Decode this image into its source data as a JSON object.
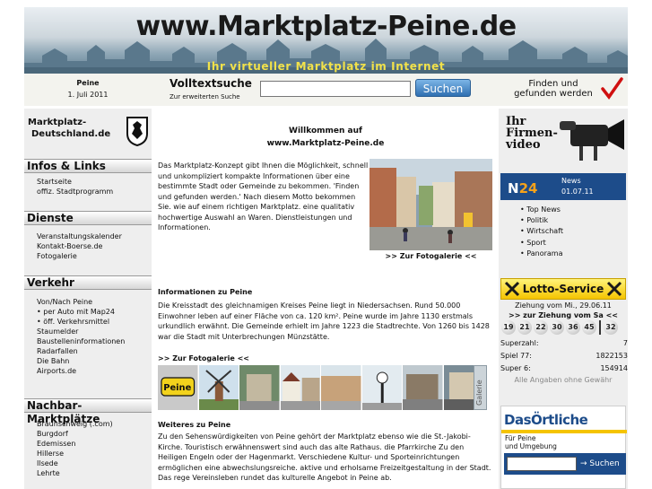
{
  "header": {
    "site_title": "www.Marktplatz-Peine.de",
    "tagline": "Ihr virtueller Marktplatz im Internet"
  },
  "location": {
    "city": "Peine",
    "date": "1. Juli 2011"
  },
  "search": {
    "title": "Volltextsuche",
    "sub": "Zur erweiterten Suche",
    "button": "Suchen",
    "slogan_line1": "Finden und",
    "slogan_line2": "gefunden werden"
  },
  "left": {
    "logo_line1": "Marktplatz-",
    "logo_line2": "Deutschland.de",
    "sections": [
      {
        "title": "Infos & Links",
        "items": [
          "Startseite",
          "offiz. Stadtprogramm"
        ]
      },
      {
        "title": "Dienste",
        "items": [
          "Veranstaltungskalender",
          "Kontakt-Boerse.de",
          "Fotogalerie"
        ]
      },
      {
        "title": "Verkehr",
        "items": [
          "Von/Nach Peine",
          "• per Auto mit Map24",
          "• öff. Verkehrsmittel",
          "Staumelder",
          "Baustelleninformationen",
          "Radarfallen",
          "Die Bahn",
          "Airports.de"
        ]
      },
      {
        "title": "Nachbar-Marktplätze",
        "items": [
          "Braunschweig (.com)",
          "Burgdorf",
          "Edemissen",
          "Hillerse",
          "Ilsede",
          "Lehrte"
        ]
      }
    ]
  },
  "main": {
    "welcome_line1": "Willkommen auf",
    "welcome_line2": "www.Marktplatz-Peine.de",
    "intro": "Das Marktplatz-Konzept gibt Ihnen die Möglichkeit, schnell und unkompliziert kompakte Informationen über eine bestimmte Stadt oder Gemeinde zu bekommen. 'Finden und gefunden werden.' Nach diesem Motto bekommen Sie. wie auf einem richtigen Marktplatz. eine qualitativ hochwertige Auswahl an Waren. Dienstleistungen und Informationen.",
    "gallery_link": ">> Zur Fotogalerie <<",
    "info_heading": "Informationen zu Peine",
    "info_text": "Die Kreisstadt des gleichnamigen Kreises Peine liegt in Niedersachsen. Rund 50.000 Einwohner leben auf einer Fläche von ca. 120 km². Peine wurde im Jahre 1130 erstmals urkundlich erwähnt. Die Gemeinde erhielt im Jahre 1223 die Stadtrechte. Von 1260 bis 1428 war die Stadt mit Unterbrechungen Münzstätte.",
    "gallery_link2": ">> Zur Fotogalerie <<",
    "gallery_tab": "Galerie",
    "sign_text": "Peine",
    "more_heading": "Weiteres zu Peine",
    "more_text": "Zu den Sehenswürdigkeiten von Peine gehört der Marktplatz ebenso wie die St.-Jakobi-Kirche. Touristisch erwähnenswert sind auch das alte Rathaus. die Pfarrkirche Zu den Heiligen Engeln oder der Hagenmarkt. Verschiedene Kultur- und Sporteinrichtungen ermöglichen eine abwechslungsreiche. aktive und erholsame Freizeitgestaltung in der Stadt. Das rege Vereinsleben rundet das kulturelle Angebot in Peine ab."
  },
  "right": {
    "firmen_line1": "Ihr",
    "firmen_line2": "Firmen-",
    "firmen_line3": "video",
    "n24_logo_n": "N",
    "n24_logo_24": "24",
    "n24_news": "News",
    "n24_date": "01.07.11",
    "n24_items": [
      "• Top News",
      "• Politik",
      "• Wirtschaft",
      "• Sport",
      "• Panorama"
    ],
    "lotto_title": "Lotto-Service",
    "lotto_draw": "Ziehung vom Mi., 29.06.11",
    "lotto_next": ">> zur Ziehung vom Sa <<",
    "lotto_numbers": [
      "19",
      "21",
      "22",
      "30",
      "36",
      "45",
      "32"
    ],
    "superzahl_label": "Superzahl:",
    "superzahl": "7",
    "spiel77_label": "Spiel 77:",
    "spiel77": "1822153",
    "super6_label": "Super 6:",
    "super6": "154914",
    "lotto_note": "Alle Angaben ohne Gewähr",
    "oertliche_logo": "DasÖrtliche",
    "oertliche_sub1": "Für Peine",
    "oertliche_sub2": "und Umgebung",
    "oertliche_btn": "→ Suchen"
  }
}
